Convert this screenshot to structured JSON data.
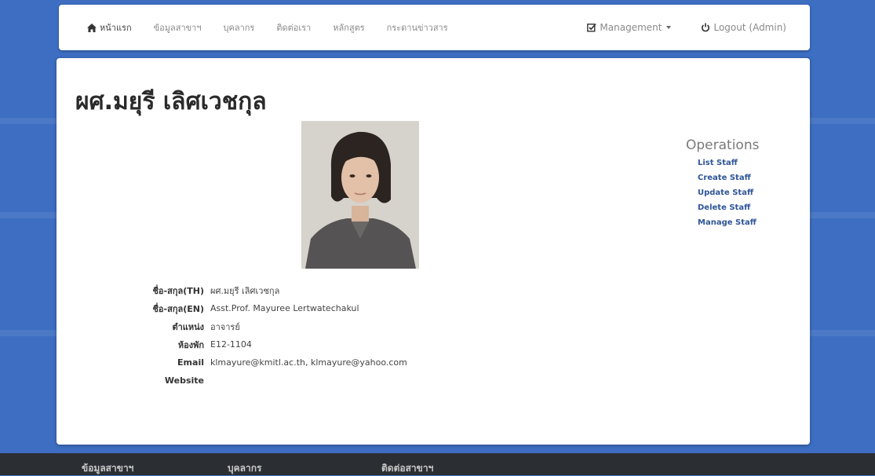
{
  "navbar": {
    "items": [
      {
        "label": "หน้าแรก",
        "icon": "home-icon"
      },
      {
        "label": "ข้อมูลสาขาฯ"
      },
      {
        "label": "บุคลากร"
      },
      {
        "label": "ติดต่อเรา"
      },
      {
        "label": "หลักสูตร"
      },
      {
        "label": "กระดานข่าวสาร"
      }
    ],
    "management": {
      "label": "Management",
      "icon": "check-square-icon"
    },
    "logout": {
      "label": "Logout (Admin)",
      "icon": "power-icon"
    }
  },
  "page": {
    "title": "ผศ.มยุรี เลิศเวชกุล"
  },
  "operations": {
    "title": "Operations",
    "links": [
      "List Staff",
      "Create Staff",
      "Update Staff",
      "Delete Staff",
      "Manage Staff"
    ]
  },
  "details": [
    {
      "label": "ชื่อ-สกุล(TH)",
      "value": "ผศ.มยุรี เลิศเวชกุล"
    },
    {
      "label": "ชื่อ-สกุล(EN)",
      "value": "Asst.Prof. Mayuree Lertwatechakul"
    },
    {
      "label": "ตำแหน่ง",
      "value": "อาจารย์"
    },
    {
      "label": "ห้องพัก",
      "value": "E12-1104"
    },
    {
      "label": "Email",
      "value": "klmayure@kmitl.ac.th, klmayure@yahoo.com"
    },
    {
      "label": "Website",
      "value": ""
    }
  ],
  "footer": {
    "items": [
      "ข้อมูลสาขาฯ",
      "บุคลากร",
      "ติดต่อสาขาฯ"
    ]
  },
  "colors": {
    "background": "#3d6ec2",
    "link": "#2f5597",
    "footer": "#2b2e33"
  }
}
